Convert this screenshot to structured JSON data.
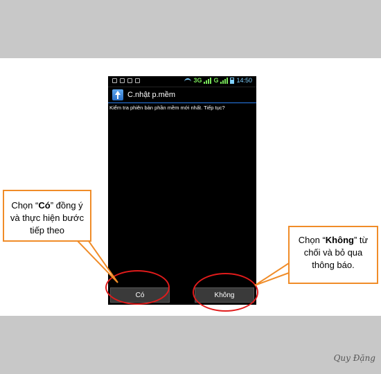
{
  "status_bar": {
    "network_3g": "3G",
    "network_g": "G",
    "time": "14:50"
  },
  "dialog": {
    "title": "C.nhật p.mềm",
    "title_icon": "upload-arrow-icon",
    "message": "Kiểm tra phiên bản phần mềm mới nhất. Tiếp tục?",
    "yes_label": "Có",
    "no_label": "Không"
  },
  "callouts": {
    "left": {
      "prefix": "Chọn “",
      "bold": "Có",
      "suffix": "” đồng ý và thực hiện bước tiếp theo"
    },
    "right": {
      "prefix": "Chọn “",
      "bold": "Không",
      "suffix": "” từ chối và bỏ qua thông báo."
    }
  },
  "signature": "Quy Đặng",
  "colors": {
    "highlight_ellipse": "#e01b1b",
    "callout_border": "#f08c28",
    "title_divider": "#2a7ff0"
  }
}
